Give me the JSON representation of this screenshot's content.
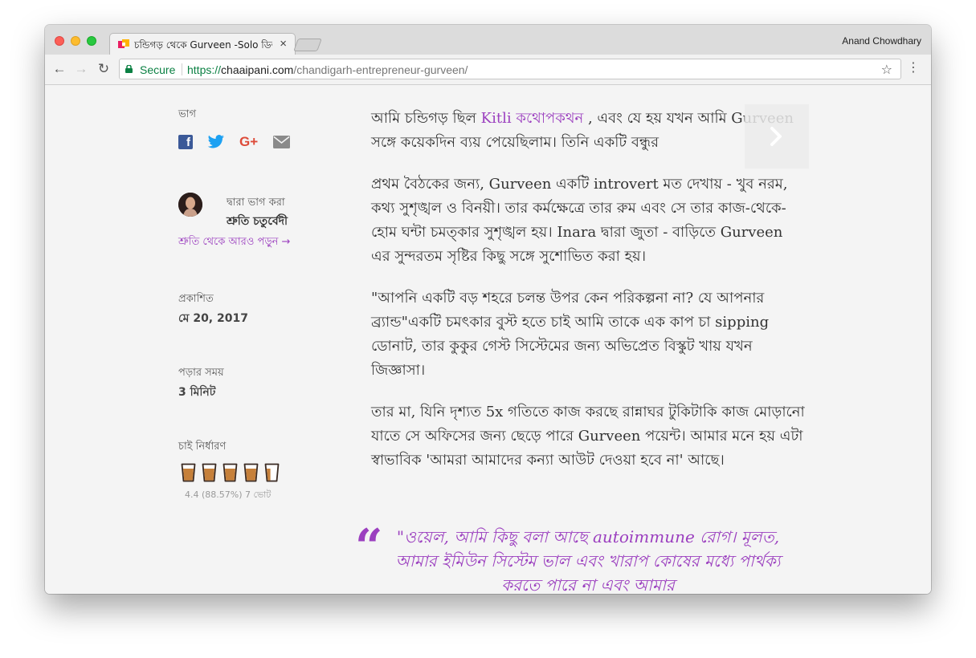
{
  "browser": {
    "tab_title": "চন্ডিগড় থেকে Gurveen -Solo ডিজাইনার",
    "tab_close": "×",
    "profile_name": "Anand Chowdhary",
    "secure_label": "Secure",
    "url_scheme": "https://",
    "url_host": "chaaipani.com",
    "url_path": "/chandigarh-entrepreneur-gurveen/",
    "back": "←",
    "forward": "→",
    "reload": "↻",
    "star": "☆",
    "menu": "⋮"
  },
  "sidebar": {
    "share_label": "ভাগ",
    "shared_by_label": "দ্বারা ভাগ করা",
    "author_name": "শ্রুতি চতুর্বেদী",
    "more_from_author": "শ্রুতি থেকে আরও পড়ুন →",
    "published_label": "প্রকাশিত",
    "published_date": "মে 20, 2017",
    "read_time_label": "পড়ার সময়",
    "read_time": "3 মিনিট",
    "rating_label": "চাই নির্ধারণ",
    "rating_text": "4.4 (88.57%) 7 ভোট",
    "rating_value": 4.4,
    "rating_max": 5,
    "icons": [
      "facebook-icon",
      "twitter-icon",
      "google-plus-icon",
      "email-icon"
    ]
  },
  "article": {
    "p1_before": "আমি চন্ডিগড় ছিল ",
    "p1_link": "Kitli কথোপকথন",
    "p1_after": " , এবং যে হয় যখন আমি Gurveen সঙ্গে কয়েকদিন ব্যয় পেয়েছিলাম। তিনি একটি বন্ধুর",
    "p2": "প্রথম বৈঠকের জন্য, Gurveen একটি introvert মত দেখায় - খুব নরম, কথ্য সুশৃঙ্খল ও বিনয়ী। তার কর্মক্ষেত্রে তার রুম এবং সে তার কাজ-থেকে-হোম ঘন্টা চমত্কার সুশৃঙ্খল হয়। Inara দ্বারা জুতা - বাড়িতে Gurveen এর সুন্দরতম সৃষ্টির কিছু সঙ্গে সুশোভিত করা হয়।",
    "p3": "\"আপনি একটি বড় শহরে চলন্ত উপর কেন পরিকল্পনা না? যে আপনার ব্র্যান্ড\"একটি চমৎকার বুস্ট হতে চাই আমি তাকে এক কাপ চা sipping ডোনাট, তার কুকুর গেস্ট সিস্টেমের জন্য অভিপ্রেত বিস্কুট খায় যখন জিজ্ঞাসা।",
    "p4": "তার মা, যিনি দৃশ্যত 5x গতিতে কাজ করছে রান্নাঘর টুকিটাকি কাজ মোড়ানো যাতে সে অফিসের জন্য ছেড়ে পারে Gurveen পয়েন্ট। আমার মনে হয় এটা স্বাভাবিক 'আমরা আমাদের কন্যা আউট দেওয়া হবে না' আছে।",
    "quote_mark": "“",
    "quote": "\"ওয়েল, আমি কিছু বলা আছে autoimmune রোগ। মূলত, আমার ইমিউন সিস্টেম ভাল এবং খারাপ কোষের মধ্যে পার্থক্য করতে পারে না এবং আমার"
  },
  "colors": {
    "accent": "#9b3fbf",
    "secure_green": "#0b8043",
    "facebook": "#3b5998",
    "twitter": "#1da1f2",
    "google_plus": "#dd4b39"
  }
}
